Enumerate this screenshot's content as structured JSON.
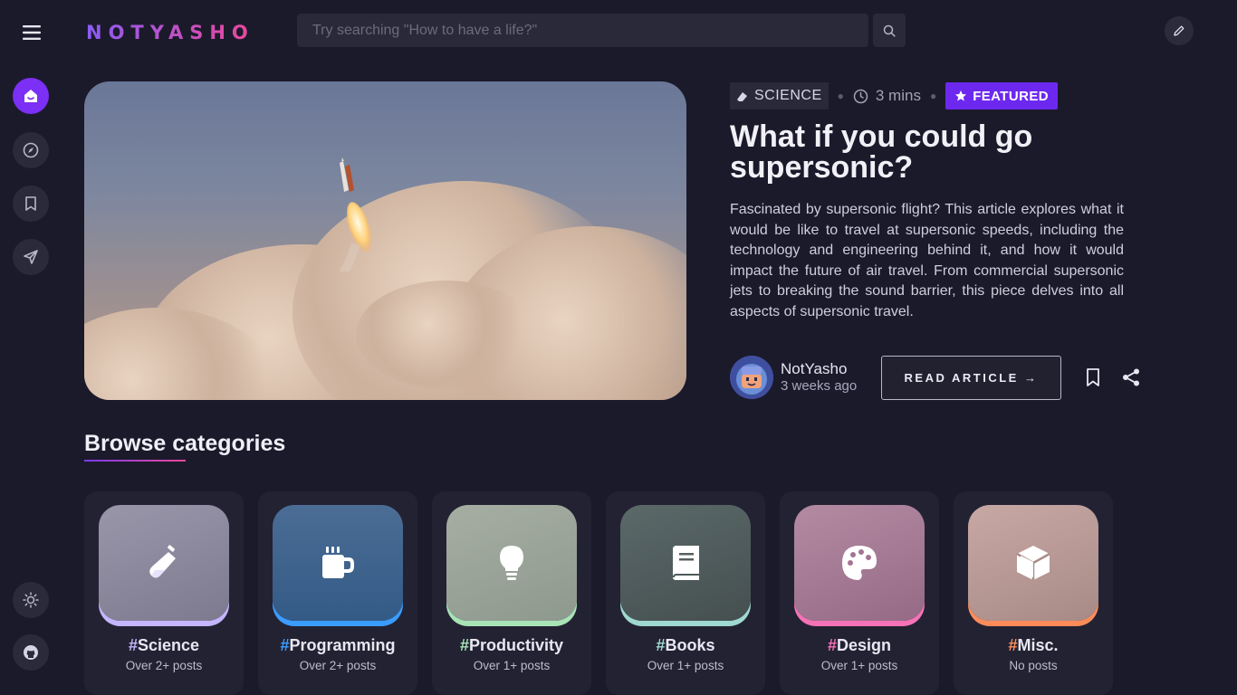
{
  "brand": {
    "logo_text": "NOTYASHO"
  },
  "search": {
    "placeholder": "Try searching \"How to have a life?\""
  },
  "header_icons": [
    "menu-icon",
    "search-icon",
    "pencil-icon"
  ],
  "sidebar_icons": [
    "home-icon",
    "compass-icon",
    "bookmark-icon",
    "send-icon",
    "sun-icon",
    "github-icon"
  ],
  "featured": {
    "category": "SCIENCE",
    "read_time": "3 mins",
    "badge": "FEATURED",
    "title": "What if you could go supersonic?",
    "excerpt": "Fascinated by supersonic flight? This article explores what it would be like to travel at supersonic speeds, including the technology and engineering behind it, and how it would impact the future of air travel. From commercial supersonic jets to breaking the sound barrier, this piece delves into all aspects of supersonic travel.",
    "author": "NotYasho",
    "posted": "3 weeks ago",
    "read_button": "READ ARTICLE →"
  },
  "categories_section": {
    "title": "Browse categories",
    "items": [
      {
        "hash": "#",
        "name": "Science",
        "count": "Over 2+ posts",
        "accent": "#c4b5fd",
        "icon": "flask-icon"
      },
      {
        "hash": "#",
        "name": "Programming",
        "count": "Over 2+ posts",
        "accent": "#3b9cff",
        "icon": "mug-icon"
      },
      {
        "hash": "#",
        "name": "Productivity",
        "count": "Over 1+ posts",
        "accent": "#a7e3b6",
        "icon": "lightbulb-icon"
      },
      {
        "hash": "#",
        "name": "Books",
        "count": "Over 1+ posts",
        "accent": "#9fd8d0",
        "icon": "book-icon"
      },
      {
        "hash": "#",
        "name": "Design",
        "count": "Over 1+ posts",
        "accent": "#f472b6",
        "icon": "palette-icon"
      },
      {
        "hash": "#",
        "name": "Misc.",
        "count": "No posts",
        "accent": "#fb8c5a",
        "icon": "cube-icon"
      }
    ]
  },
  "colors": {
    "accent": "#7c2ff5",
    "background": "#1b1a2b"
  }
}
